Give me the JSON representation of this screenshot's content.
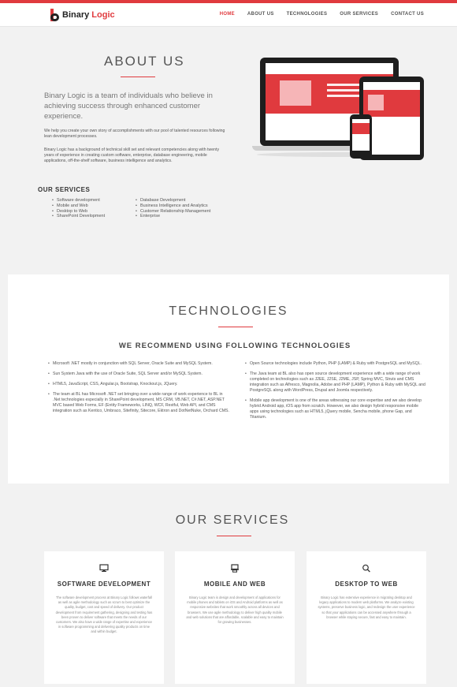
{
  "brand": {
    "name_part1": "Binary ",
    "name_part2": "Logic"
  },
  "nav": [
    {
      "label": "HOME",
      "active": true
    },
    {
      "label": "ABOUT US",
      "active": false
    },
    {
      "label": "TECHNOLOGIES",
      "active": false
    },
    {
      "label": "OUR SERVICES",
      "active": false
    },
    {
      "label": "CONTACT US",
      "active": false
    }
  ],
  "about": {
    "title": "ABOUT US",
    "lead": "Binary Logic is a team of individuals who believe in achieving success through enhanced customer experience.",
    "paragraph1": "We help you create your own story of accomplishments with our pool of talented resources following lean development processes.",
    "paragraph2": "Binary Logic has a background of technical skill set and relevant competencies along with twenty years of experience in creating custom software, enterprise, database engineering, mobile applications, off-the-shelf software, business intelligence and analytics.",
    "services_heading": "OUR SERVICES",
    "services_left": [
      "Software development",
      "Mobile and Web",
      "Desktop to Web",
      "SharePoint Development"
    ],
    "services_right": [
      "Database Development",
      "Business Intelligence and Analytics",
      "Customer Relationship Management",
      "Enterprise"
    ]
  },
  "technologies": {
    "title": "TECHNOLOGIES",
    "subtitle": "WE RECOMMEND USING FOLLOWING TECHNOLOGIES",
    "left": [
      "Microsoft .NET mostly in conjunction with SQL Server, Oracle Suite and MySQL System.",
      "Sun System Java with the use of Oracle Suite, SQL Server and/or MySQL System.",
      "HTML5, JavaScript, CSS, Angular.js, Bootstrap, Knockout.js, JQuery.",
      "The team at BL has Microsoft .NET set bringing over a wide range of work experience to BL in .Net technologies especially in SharePoint development, MS CRM, VB.NET, C#.NET, ASP.NET MVC based Web Forms, EF (Entity Frameworks, LINQ, WCF, Restful, Web API, and CMS integration such as Kentico, Umbraco, Sitefinity, Sitecore, Ektron and DotNetNuke, Orchard CMS."
    ],
    "right": [
      "Open Source technologies include Python, PHP (LAMP) & Ruby with PostgreSQL and MySQL.",
      "The Java team at BL also has open source development experience with a wide range of work completed on technologies such as J2EE, J2SE, J2ME, JSP, Spring MVC, Struts and CMS integration such as Alfresco, Magnolia, Adobe and PHP (LAMP), Python & Ruby with MySQL and PostgreSQL along with WordPress, Drupal and Joomla respectively.",
      "Mobile app development is one of the areas witnessing our core expertise and we also develop hybrid Android app, iOS app from scratch. However, we also design hybrid responsive mobile apps using technologies such as HTML5, jQuery mobile, Sencha mobile, phone Gap, and Titanium."
    ]
  },
  "services": {
    "title": "OUR SERVICES",
    "cards": [
      {
        "icon": "monitor-icon",
        "title": "SOFTWARE DEVELOPMENT",
        "text": "The software development process at Binary Logic follows waterfall as well as agile methodology such as scrum to best optimize the quality, budget, cost and speed of delivery. Our product development from requirement gathering, designing and testing has been proven to deliver software that meets the needs of our customers. We also have a wide range of expertise and experience in software programming and delivering quality products on time and within budget."
      },
      {
        "icon": "devices-icon",
        "title": "MOBILE AND WEB",
        "text": "Binary Logic team is design and development of applications for mobile phones and tablets on iOS and Android platforms as well as responsive websites that work smoothly across all devices and browsers. We use agile methodology to deliver high quality mobile and web solutions that are affordable, scalable and easy to maintain for growing businesses."
      },
      {
        "icon": "search-icon",
        "title": "DESKTOP TO WEB",
        "text": "Binary Logic has extensive experience in migrating desktop and legacy applications to modern web platforms. We analyze existing systems, preserve business logic, and redesign the user experience so that your applications can be accessed anywhere through a browser while staying secure, fast and easy to maintain."
      }
    ]
  },
  "colors": {
    "accent": "#e03a3e",
    "background": "#f2f2f2",
    "surface": "#ffffff"
  }
}
